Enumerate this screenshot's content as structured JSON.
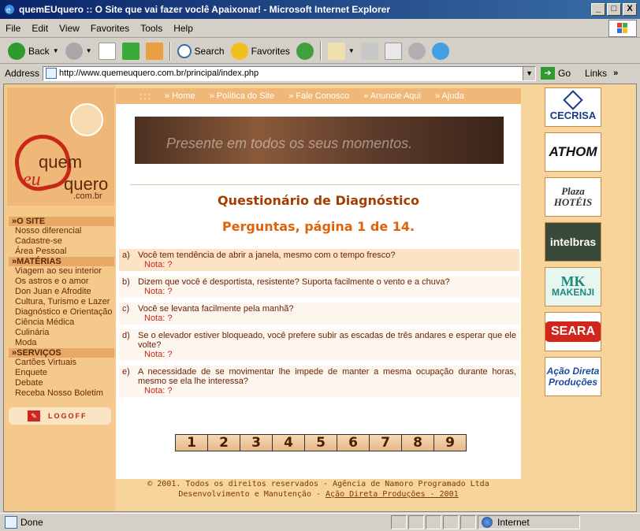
{
  "window": {
    "title": "quemEUquero :: O Site que vai fazer voclê Apaixonar! - Microsoft Internet Explorer",
    "minimize": "_",
    "maximize": "□",
    "close": "X"
  },
  "menu": [
    "File",
    "Edit",
    "View",
    "Favorites",
    "Tools",
    "Help"
  ],
  "toolbar": {
    "back": "Back",
    "search": "Search",
    "favorites": "Favorites"
  },
  "address": {
    "label": "Address",
    "url": "http://www.quemeuquero.com.br/principal/index.php",
    "go": "Go",
    "links": "Links"
  },
  "logo": {
    "part1": "quem",
    "part2": "eu",
    "part3": "quero",
    "part4": ".com.br"
  },
  "sidebar": {
    "sections": [
      {
        "title": "»O SITE",
        "links": [
          "Nosso diferencial",
          "Cadastre-se",
          "Área Pessoal"
        ]
      },
      {
        "title": "»MATÉRIAS",
        "links": [
          "Viagem ao seu interior",
          "Os astros e o amor",
          "Don Juan e Afrodite",
          "Cultura, Turismo e Lazer",
          "Diagnóstico e Orientação",
          "Ciência Médica",
          "Culinária",
          "Moda"
        ]
      },
      {
        "title": "»SERVIÇOS",
        "links": [
          "Cartões Virtuais",
          "Enquete",
          "Debate",
          "Receba Nosso Boletim"
        ]
      }
    ],
    "logoff": "LOGOFF"
  },
  "topnav": {
    "dots": ":::",
    "items": [
      "Home",
      "Política do Site",
      "Fale Conosco",
      "Anuncie Aqui",
      "Ajuda"
    ]
  },
  "banner": {
    "text": "Presente em todos os seus momentos."
  },
  "main": {
    "title": "Questionário de Diagnóstico",
    "subtitle": "Perguntas, página 1 de 14.",
    "questions": [
      {
        "letter": "a)",
        "text": "Você tem tendência de abrir a janela, mesmo com o tempo fresco?",
        "note": "Nota: ?"
      },
      {
        "letter": "b)",
        "text": "Dizem que você é desportista, resistente? Suporta facilmente o vento e a chuva?",
        "note": "Nota: ?"
      },
      {
        "letter": "c)",
        "text": "Você se levanta facilmente pela manhã?",
        "note": "Nota: ?"
      },
      {
        "letter": "d)",
        "text": "Se o elevador estiver bloqueado, você prefere subir as escadas de três andares e esperar que ele volte?",
        "note": "Nota: ?"
      },
      {
        "letter": "e)",
        "text": "A necessidade de se movimentar lhe impede de manter a mesma ocupação durante horas, mesmo se ela lhe interessa?",
        "note": "Nota: ?"
      }
    ],
    "pages": [
      "1",
      "2",
      "3",
      "4",
      "5",
      "6",
      "7",
      "8",
      "9"
    ]
  },
  "footer": {
    "line1": "© 2001. Todos os direitos reservados - Agência de Namoro Programado Ltda",
    "line2_prefix": "Desenvolvimento e Manutenção - ",
    "line2_link": "Ação Direta Produções - 2001"
  },
  "sponsors": [
    "CECRISA",
    "ATHOM",
    "Plaza HOTÉIS",
    "intelbras",
    "MAKENJI",
    "SEARA",
    "Ação Direta Produções"
  ],
  "status": {
    "text": "Done",
    "zone": "Internet"
  },
  "colors": {
    "page_bg": "#f7d49b",
    "accent": "#a63d00",
    "subtitle": "#e0620a",
    "nav_tab": "#f0b878"
  }
}
